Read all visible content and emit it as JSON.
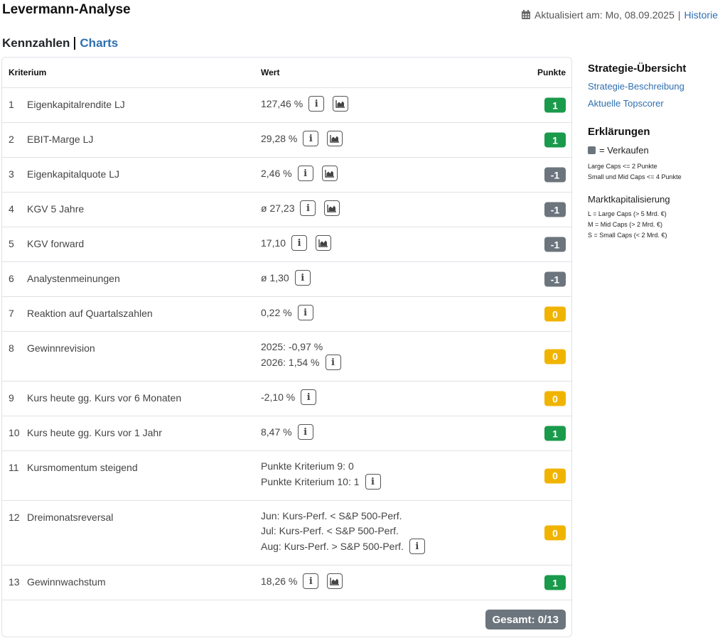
{
  "header": {
    "title": "Levermann-Analyse",
    "updated_label": "Aktualisiert am: Mo, 08.09.2025",
    "separator": "|",
    "history_link": "Historie"
  },
  "subnav": {
    "active": "Kennzahlen",
    "charts_link": "Charts"
  },
  "table": {
    "col_criterion": "Kriterium",
    "col_value": "Wert",
    "col_points": "Punkte",
    "rows": [
      {
        "num": "1",
        "criterion": "Eigenkapitalrendite LJ",
        "lines": [
          "127,46 %"
        ],
        "info": true,
        "chart": true,
        "points": "1",
        "color": "green"
      },
      {
        "num": "2",
        "criterion": "EBIT-Marge LJ",
        "lines": [
          "29,28 %"
        ],
        "info": true,
        "chart": true,
        "points": "1",
        "color": "green"
      },
      {
        "num": "3",
        "criterion": "Eigenkapitalquote LJ",
        "lines": [
          "2,46 %"
        ],
        "info": true,
        "chart": true,
        "points": "-1",
        "color": "gray"
      },
      {
        "num": "4",
        "criterion": "KGV 5 Jahre",
        "lines": [
          "ø 27,23"
        ],
        "info": true,
        "chart": true,
        "points": "-1",
        "color": "gray"
      },
      {
        "num": "5",
        "criterion": "KGV forward",
        "lines": [
          "17,10"
        ],
        "info": true,
        "chart": true,
        "points": "-1",
        "color": "gray"
      },
      {
        "num": "6",
        "criterion": "Analystenmeinungen",
        "lines": [
          "ø 1,30"
        ],
        "info": true,
        "chart": false,
        "points": "-1",
        "color": "gray"
      },
      {
        "num": "7",
        "criterion": "Reaktion auf Quartalszahlen",
        "lines": [
          "0,22 %"
        ],
        "info": true,
        "chart": false,
        "points": "0",
        "color": "yellow"
      },
      {
        "num": "8",
        "criterion": "Gewinnrevision",
        "lines": [
          "2025: -0,97 %",
          "2026: 1,54 %"
        ],
        "info": true,
        "chart": false,
        "points": "0",
        "color": "yellow"
      },
      {
        "num": "9",
        "criterion": "Kurs heute gg. Kurs vor 6 Monaten",
        "lines": [
          "-2,10 %"
        ],
        "info": true,
        "chart": false,
        "points": "0",
        "color": "yellow"
      },
      {
        "num": "10",
        "criterion": "Kurs heute gg. Kurs vor 1 Jahr",
        "lines": [
          "8,47 %"
        ],
        "info": true,
        "chart": false,
        "points": "1",
        "color": "green"
      },
      {
        "num": "11",
        "criterion": "Kursmomentum steigend",
        "lines": [
          "Punkte Kriterium 9: 0",
          "Punkte Kriterium 10: 1"
        ],
        "info": true,
        "chart": false,
        "points": "0",
        "color": "yellow"
      },
      {
        "num": "12",
        "criterion": "Dreimonatsreversal",
        "lines": [
          "Jun: Kurs-Perf. < S&P 500-Perf.",
          "Jul: Kurs-Perf. < S&P 500-Perf.",
          "Aug: Kurs-Perf. > S&P 500-Perf."
        ],
        "info": true,
        "chart": false,
        "points": "0",
        "color": "yellow"
      },
      {
        "num": "13",
        "criterion": "Gewinnwachstum",
        "lines": [
          "18,26 %"
        ],
        "info": true,
        "chart": true,
        "points": "1",
        "color": "green"
      }
    ],
    "total": "Gesamt: 0/13"
  },
  "sidebar": {
    "strategy_title": "Strategie-Übersicht",
    "strategy_links": [
      "Strategie-Beschreibung",
      "Aktuelle Topscorer"
    ],
    "explain_title": "Erklärungen",
    "legend_sell": "= Verkaufen",
    "rules": [
      "Large Caps <= 2 Punkte",
      "Small und Mid Caps <= 4 Punkte"
    ],
    "market_cap_title": "Marktkapitalisierung",
    "market_caps": [
      "L = Large Caps (> 5 Mrd. €)",
      "M = Mid Caps (> 2 Mrd. €)",
      "S = Small Caps (< 2 Mrd. €)"
    ]
  },
  "colors": {
    "green": "#1a9a4b",
    "gray": "#6c757d",
    "yellow": "#f0b400",
    "link": "#2f6fb0"
  },
  "icons": {
    "info": "info-icon",
    "chart": "area-chart-icon",
    "calendar": "calendar-icon"
  }
}
